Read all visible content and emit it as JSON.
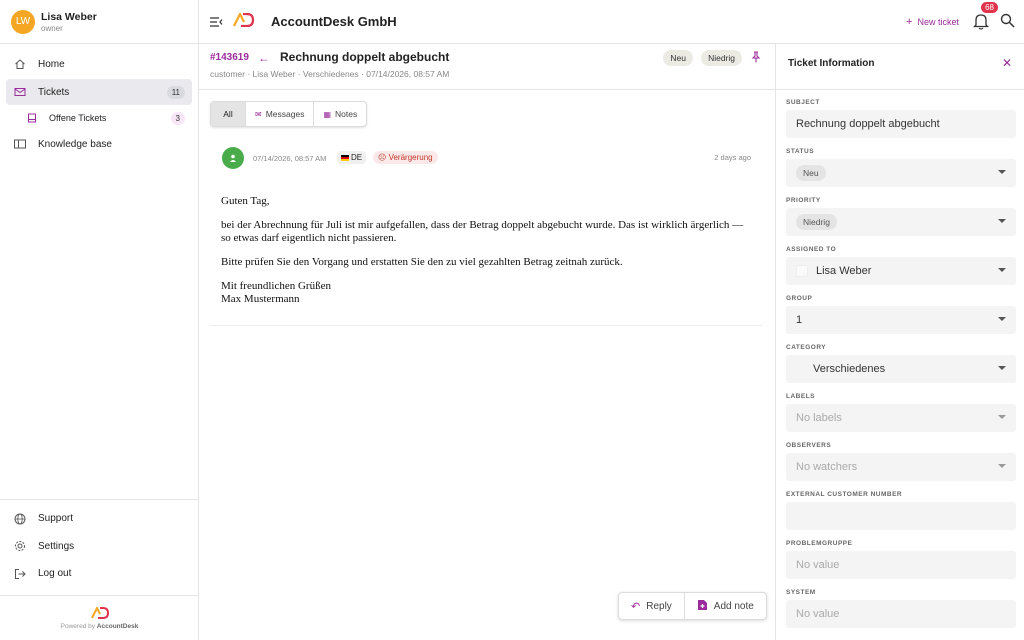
{
  "user": {
    "initials": "LW",
    "name": "Lisa Weber",
    "role": "owner"
  },
  "sidebar": {
    "items": [
      {
        "label": "Home"
      },
      {
        "label": "Tickets",
        "count": "11"
      },
      {
        "label": "Offene Tickets",
        "count": "3"
      },
      {
        "label": "Knowledge base"
      }
    ],
    "bottom": [
      {
        "label": "Support"
      },
      {
        "label": "Settings"
      },
      {
        "label": "Log out"
      }
    ],
    "powered_prefix": "Powered by",
    "powered_brand": "AccountDesk"
  },
  "topbar": {
    "company": "AccountDesk GmbH",
    "new_ticket": "New ticket",
    "notification_count": "68"
  },
  "ticket": {
    "id": "#143619",
    "title": "Rechnung doppelt abgebucht",
    "meta": "customer · Lisa Weber · Verschiedenes · 07/14/2026, 08:57 AM",
    "status_tag": "Neu",
    "priority_tag": "Niedrig"
  },
  "filters": {
    "all": "All",
    "messages": "Messages",
    "notes": "Notes"
  },
  "message": {
    "date": "07/14/2026, 08:57 AM",
    "language": "DE",
    "sentiment": "Verärgerung",
    "ago": "2 days ago",
    "greeting": "Guten Tag,",
    "paragraph1": "bei der Abrechnung für Juli ist mir aufgefallen, dass der Betrag doppelt abgebucht wurde. Das ist wirklich ärgerlich — so etwas darf eigentlich nicht passieren.",
    "paragraph2": "Bitte prüfen Sie den Vorgang und erstatten Sie den zu viel gezahlten Betrag zeitnah zurück.",
    "closing": "Mit freundlichen Grüßen",
    "signature": "Max Mustermann"
  },
  "actions": {
    "reply": "Reply",
    "add_note": "Add note"
  },
  "panel": {
    "title": "Ticket Information",
    "fields": [
      {
        "label": "SUBJECT",
        "value": "Rechnung doppelt abgebucht"
      },
      {
        "label": "STATUS",
        "value": "Neu"
      },
      {
        "label": "PRIORITY",
        "value": "Niedrig"
      },
      {
        "label": "ASSIGNED TO",
        "value": "Lisa Weber"
      },
      {
        "label": "GROUP",
        "value": "1"
      },
      {
        "label": "CATEGORY",
        "value": "Verschiedenes"
      },
      {
        "label": "LABELS",
        "value": "No labels"
      },
      {
        "label": "OBSERVERS",
        "value": "No watchers"
      },
      {
        "label": "EXTERNAL CUSTOMER NUMBER",
        "value": ""
      },
      {
        "label": "PROBLEMGRUPPE",
        "value": "No value"
      },
      {
        "label": "SYSTEM",
        "value": "No value"
      }
    ]
  },
  "colors": {
    "accent": "#9b2c9b",
    "avatar": "#f5a623",
    "badge": "#e0344d",
    "customer_avatar": "#4aab4a"
  }
}
